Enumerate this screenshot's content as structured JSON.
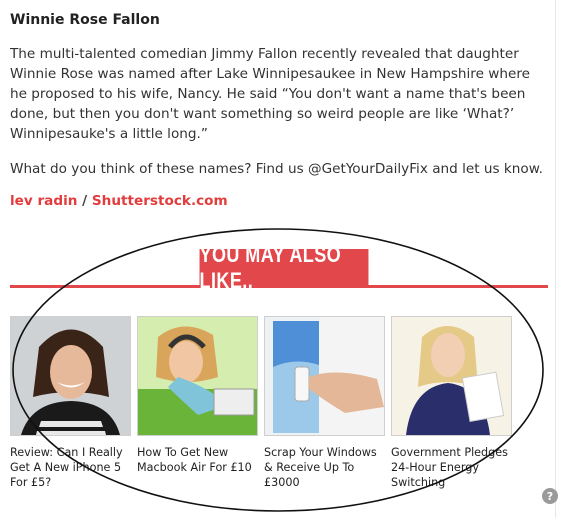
{
  "article": {
    "title": "Winnie Rose Fallon",
    "body": "The multi-talented comedian Jimmy Fallon recently revealed that daughter Winnie Rose was named after Lake Winnipesaukee in New Hampshire where he proposed to his wife, Nancy. He said “You don't want a name that's been done, but then you don't want something so weird people are like ‘What?’ Winnipesauke's a little long.”",
    "question": "What do you think of these names? Find us @GetYourDailyFix and let us know.",
    "credit_author": "lev radin",
    "credit_separator": "/",
    "credit_source": "Shutterstock.com"
  },
  "recommendations": {
    "heading": "YOU MAY ALSO LIKE..",
    "items": [
      {
        "caption": "Review: Can I Really Get A New iPhone 5 For £5?"
      },
      {
        "caption": "How To Get New Macbook Air For £10"
      },
      {
        "caption": "Scrap Your Windows & Receive Up To £3000"
      },
      {
        "caption": "Government Pledges 24-Hour Energy Switching"
      }
    ]
  },
  "help": {
    "icon": "help-icon",
    "glyph": "?"
  },
  "colors": {
    "accent": "#e2474b",
    "text": "#333333"
  }
}
